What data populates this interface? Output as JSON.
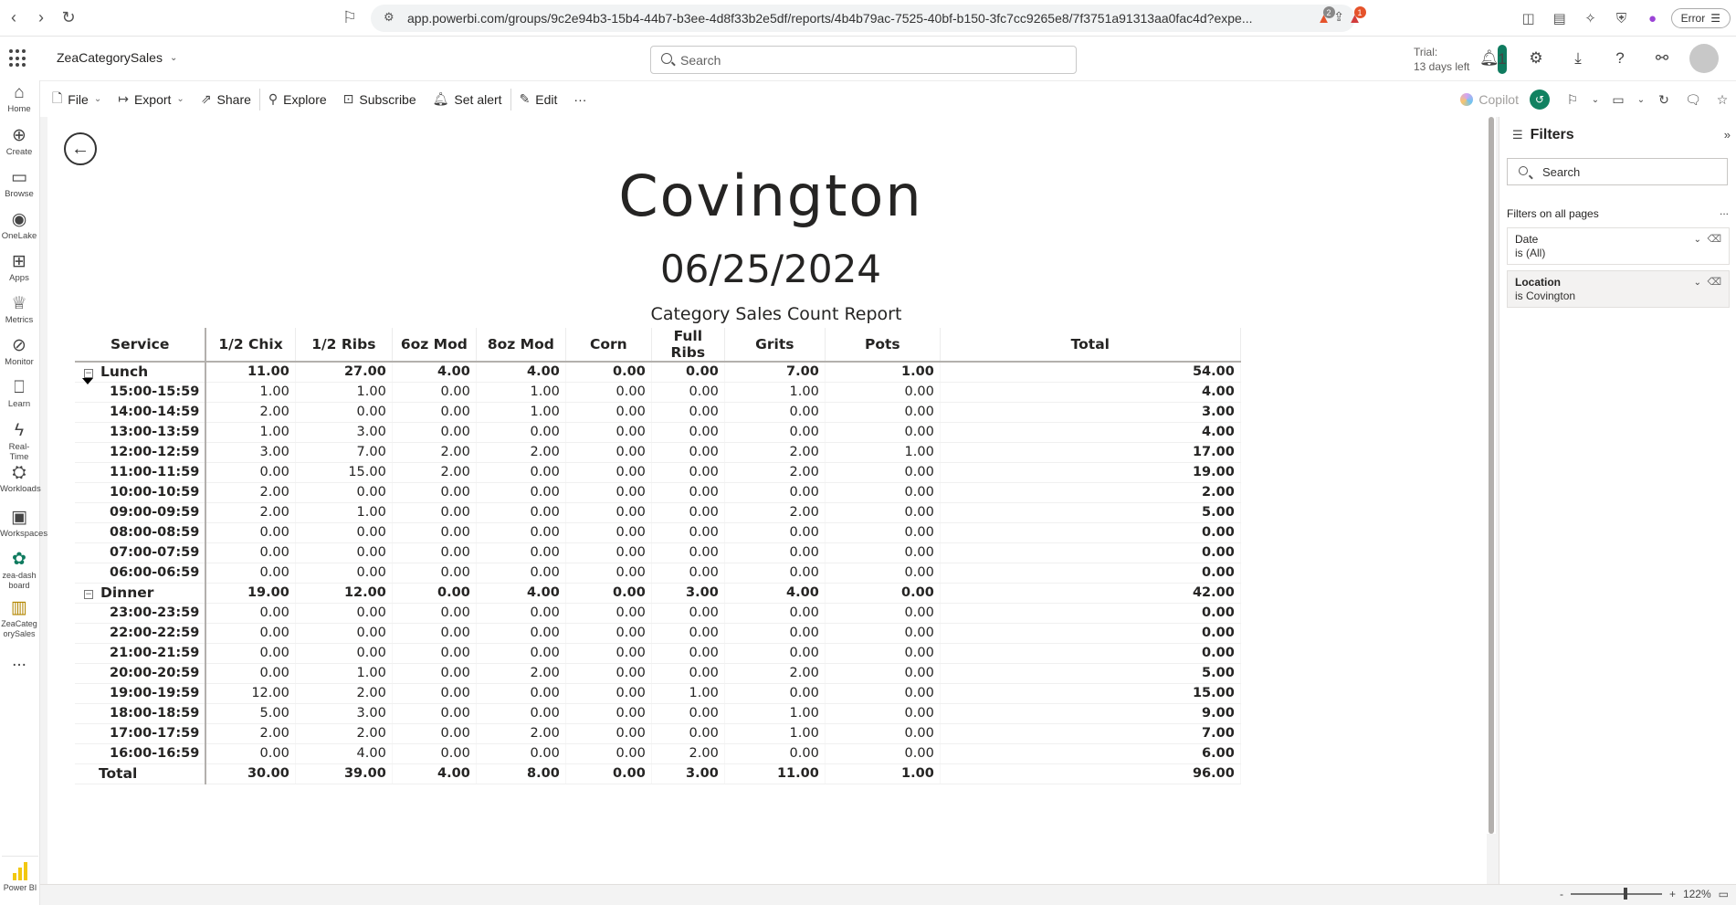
{
  "browser": {
    "url": "app.powerbi.com/groups/9c2e94b3-15b4-44b7-b3ee-4d8f33b2e5df/reports/4b4b79ac-7525-40bf-b150-3fc7cc9265e8/7f3751a91313aa0fac4d?expe...",
    "error_label": "Error",
    "badge_1": "2",
    "badge_2": "1"
  },
  "app": {
    "name": "ZeaCategorySales",
    "search_placeholder": "Search",
    "trial_line1": "Trial:",
    "trial_line2": "13 days left",
    "notification_count": "1"
  },
  "nav": [
    {
      "label": "Home",
      "icon": "home-icon",
      "glyph": "⌂"
    },
    {
      "label": "Create",
      "icon": "create-icon",
      "glyph": "⊕"
    },
    {
      "label": "Browse",
      "icon": "browse-icon",
      "glyph": "▭"
    },
    {
      "label": "OneLake",
      "icon": "onelake-icon",
      "glyph": "◉"
    },
    {
      "label": "Apps",
      "icon": "apps-icon",
      "glyph": "⊞"
    },
    {
      "label": "Metrics",
      "icon": "metrics-icon",
      "glyph": "♕"
    },
    {
      "label": "Monitor",
      "icon": "monitor-icon",
      "glyph": "⊘"
    },
    {
      "label": "Learn",
      "icon": "learn-icon",
      "glyph": "⎕"
    },
    {
      "label": "Real-Time",
      "icon": "realtime-icon",
      "glyph": "ϟ"
    },
    {
      "label": "Workloads",
      "icon": "workloads-icon",
      "glyph": "⛭"
    },
    {
      "label": "Workspaces",
      "icon": "workspaces-icon",
      "glyph": "▣"
    },
    {
      "label": "zea-dashboard",
      "icon": "workspace-icon",
      "glyph": "✿"
    },
    {
      "label": "ZeaCategorySales",
      "icon": "report-icon",
      "glyph": "▥"
    }
  ],
  "nav_more": "...",
  "powerbi_label": "Power BI",
  "toolbar": {
    "file": "File",
    "export": "Export",
    "share": "Share",
    "explore": "Explore",
    "subscribe": "Subscribe",
    "set_alert": "Set alert",
    "edit": "Edit",
    "more": "···",
    "copilot": "Copilot"
  },
  "report": {
    "title": "Covington",
    "date": "06/25/2024",
    "subtitle": "Category Sales Count Report"
  },
  "matrix": {
    "columns": [
      "Service",
      "1/2 Chix",
      "1/2 Ribs",
      "6oz Mod",
      "8oz Mod",
      "Corn",
      "Full Ribs",
      "Grits",
      "Pots",
      "Total"
    ],
    "groups": [
      {
        "name": "Lunch",
        "values": [
          "11.00",
          "27.00",
          "4.00",
          "4.00",
          "0.00",
          "0.00",
          "7.00",
          "1.00",
          "54.00"
        ],
        "rows": [
          {
            "label": "15:00-15:59",
            "values": [
              "1.00",
              "1.00",
              "0.00",
              "1.00",
              "0.00",
              "0.00",
              "1.00",
              "0.00",
              "4.00"
            ]
          },
          {
            "label": "14:00-14:59",
            "values": [
              "2.00",
              "0.00",
              "0.00",
              "1.00",
              "0.00",
              "0.00",
              "0.00",
              "0.00",
              "3.00"
            ]
          },
          {
            "label": "13:00-13:59",
            "values": [
              "1.00",
              "3.00",
              "0.00",
              "0.00",
              "0.00",
              "0.00",
              "0.00",
              "0.00",
              "4.00"
            ]
          },
          {
            "label": "12:00-12:59",
            "values": [
              "3.00",
              "7.00",
              "2.00",
              "2.00",
              "0.00",
              "0.00",
              "2.00",
              "1.00",
              "17.00"
            ]
          },
          {
            "label": "11:00-11:59",
            "values": [
              "0.00",
              "15.00",
              "2.00",
              "0.00",
              "0.00",
              "0.00",
              "2.00",
              "0.00",
              "19.00"
            ]
          },
          {
            "label": "10:00-10:59",
            "values": [
              "2.00",
              "0.00",
              "0.00",
              "0.00",
              "0.00",
              "0.00",
              "0.00",
              "0.00",
              "2.00"
            ]
          },
          {
            "label": "09:00-09:59",
            "values": [
              "2.00",
              "1.00",
              "0.00",
              "0.00",
              "0.00",
              "0.00",
              "2.00",
              "0.00",
              "5.00"
            ]
          },
          {
            "label": "08:00-08:59",
            "values": [
              "0.00",
              "0.00",
              "0.00",
              "0.00",
              "0.00",
              "0.00",
              "0.00",
              "0.00",
              "0.00"
            ]
          },
          {
            "label": "07:00-07:59",
            "values": [
              "0.00",
              "0.00",
              "0.00",
              "0.00",
              "0.00",
              "0.00",
              "0.00",
              "0.00",
              "0.00"
            ]
          },
          {
            "label": "06:00-06:59",
            "values": [
              "0.00",
              "0.00",
              "0.00",
              "0.00",
              "0.00",
              "0.00",
              "0.00",
              "0.00",
              "0.00"
            ]
          }
        ]
      },
      {
        "name": "Dinner",
        "values": [
          "19.00",
          "12.00",
          "0.00",
          "4.00",
          "0.00",
          "3.00",
          "4.00",
          "0.00",
          "42.00"
        ],
        "rows": [
          {
            "label": "23:00-23:59",
            "values": [
              "0.00",
              "0.00",
              "0.00",
              "0.00",
              "0.00",
              "0.00",
              "0.00",
              "0.00",
              "0.00"
            ]
          },
          {
            "label": "22:00-22:59",
            "values": [
              "0.00",
              "0.00",
              "0.00",
              "0.00",
              "0.00",
              "0.00",
              "0.00",
              "0.00",
              "0.00"
            ]
          },
          {
            "label": "21:00-21:59",
            "values": [
              "0.00",
              "0.00",
              "0.00",
              "0.00",
              "0.00",
              "0.00",
              "0.00",
              "0.00",
              "0.00"
            ]
          },
          {
            "label": "20:00-20:59",
            "values": [
              "0.00",
              "1.00",
              "0.00",
              "2.00",
              "0.00",
              "0.00",
              "2.00",
              "0.00",
              "5.00"
            ]
          },
          {
            "label": "19:00-19:59",
            "values": [
              "12.00",
              "2.00",
              "0.00",
              "0.00",
              "0.00",
              "1.00",
              "0.00",
              "0.00",
              "15.00"
            ]
          },
          {
            "label": "18:00-18:59",
            "values": [
              "5.00",
              "3.00",
              "0.00",
              "0.00",
              "0.00",
              "0.00",
              "1.00",
              "0.00",
              "9.00"
            ]
          },
          {
            "label": "17:00-17:59",
            "values": [
              "2.00",
              "2.00",
              "0.00",
              "2.00",
              "0.00",
              "0.00",
              "1.00",
              "0.00",
              "7.00"
            ]
          },
          {
            "label": "16:00-16:59",
            "values": [
              "0.00",
              "4.00",
              "0.00",
              "0.00",
              "0.00",
              "2.00",
              "0.00",
              "0.00",
              "6.00"
            ]
          }
        ]
      }
    ],
    "total": {
      "label": "Total",
      "values": [
        "30.00",
        "39.00",
        "4.00",
        "8.00",
        "0.00",
        "3.00",
        "11.00",
        "1.00",
        "96.00"
      ]
    }
  },
  "filters": {
    "title": "Filters",
    "search_placeholder": "Search",
    "section": "Filters on all pages",
    "more": "...",
    "cards": [
      {
        "name": "Date",
        "value": "is (All)",
        "active": false
      },
      {
        "name": "Location",
        "value": "is Covington",
        "active": true
      }
    ]
  },
  "status": {
    "zoom_minus": "-",
    "zoom_plus": "+",
    "zoom_level": "122%"
  }
}
